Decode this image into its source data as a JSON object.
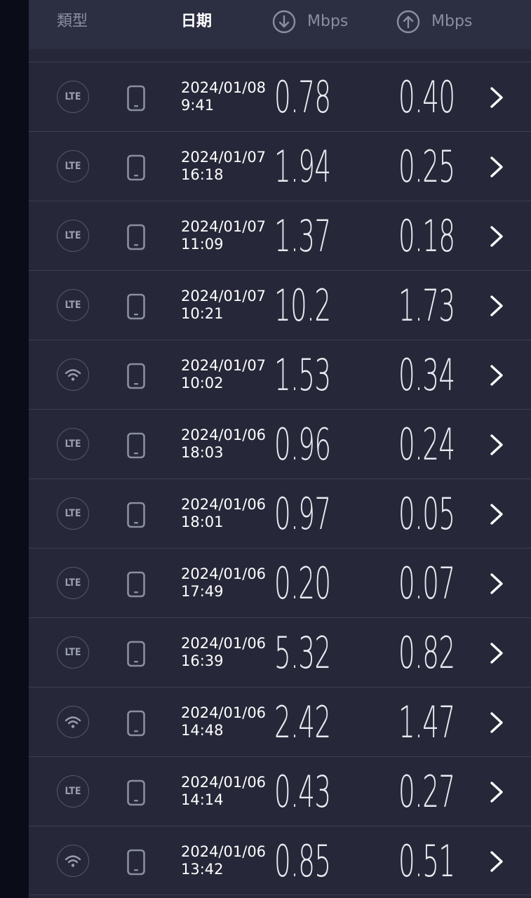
{
  "header": {
    "type_label": "類型",
    "date_label": "日期",
    "download_unit": "Mbps",
    "upload_unit": "Mbps",
    "download_icon": "arrow-down-circle-icon",
    "upload_icon": "arrow-up-circle-icon"
  },
  "colors": {
    "background": "#262839",
    "header": "#2c2f41",
    "text": "#ffffff",
    "muted": "#8a8ea0"
  },
  "rows": [
    {
      "type": "LTE",
      "date": "2024/01/08",
      "time": "9:41",
      "download": "0.78",
      "upload": "0.40"
    },
    {
      "type": "LTE",
      "date": "2024/01/07",
      "time": "16:18",
      "download": "1.94",
      "upload": "0.25"
    },
    {
      "type": "LTE",
      "date": "2024/01/07",
      "time": "11:09",
      "download": "1.37",
      "upload": "0.18"
    },
    {
      "type": "LTE",
      "date": "2024/01/07",
      "time": "10:21",
      "download": "10.2",
      "upload": "1.73"
    },
    {
      "type": "wifi",
      "date": "2024/01/07",
      "time": "10:02",
      "download": "1.53",
      "upload": "0.34"
    },
    {
      "type": "LTE",
      "date": "2024/01/06",
      "time": "18:03",
      "download": "0.96",
      "upload": "0.24"
    },
    {
      "type": "LTE",
      "date": "2024/01/06",
      "time": "18:01",
      "download": "0.97",
      "upload": "0.05"
    },
    {
      "type": "LTE",
      "date": "2024/01/06",
      "time": "17:49",
      "download": "0.20",
      "upload": "0.07"
    },
    {
      "type": "LTE",
      "date": "2024/01/06",
      "time": "16:39",
      "download": "5.32",
      "upload": "0.82"
    },
    {
      "type": "wifi",
      "date": "2024/01/06",
      "time": "14:48",
      "download": "2.42",
      "upload": "1.47"
    },
    {
      "type": "LTE",
      "date": "2024/01/06",
      "time": "14:14",
      "download": "0.43",
      "upload": "0.27"
    },
    {
      "type": "wifi",
      "date": "2024/01/06",
      "time": "13:42",
      "download": "0.85",
      "upload": "0.51"
    }
  ]
}
